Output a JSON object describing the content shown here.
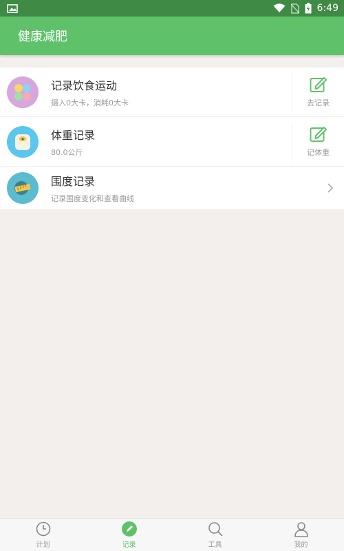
{
  "status_bar": {
    "time": "6:49"
  },
  "app_bar": {
    "title": "健康减肥"
  },
  "list": [
    {
      "title": "记录饮食运动",
      "subtitle": "摄入0大卡，消耗0大卡",
      "action_label": "去记录",
      "icon": "diet-exercise-icon"
    },
    {
      "title": "体重记录",
      "subtitle": "80.0公斤",
      "action_label": "记体重",
      "icon": "scale-icon"
    },
    {
      "title": "围度记录",
      "subtitle": "记录围度变化和查看曲线",
      "icon": "tape-measure-icon"
    }
  ],
  "bottom_nav": [
    {
      "label": "计划",
      "icon": "clock-icon",
      "active": false
    },
    {
      "label": "记录",
      "icon": "pencil-icon",
      "active": true
    },
    {
      "label": "工具",
      "icon": "search-icon",
      "active": false
    },
    {
      "label": "我的",
      "icon": "person-icon",
      "active": false
    }
  ],
  "colors": {
    "primary": "#5fc26b",
    "status_bar": "#3f8a44",
    "background": "#f3efec"
  }
}
